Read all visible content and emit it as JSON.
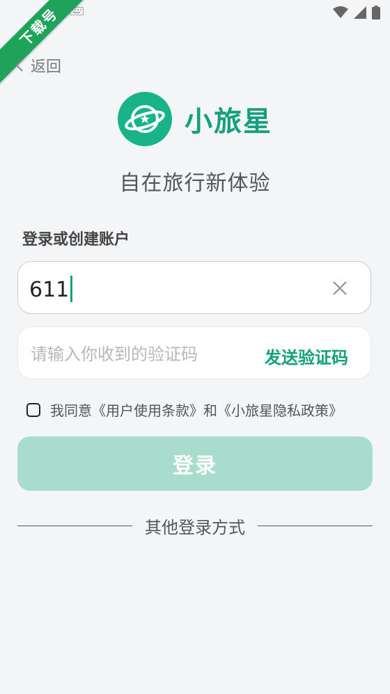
{
  "status_bar": {
    "icons": [
      "keyboard-icon",
      "wifi-icon",
      "signal-icon",
      "battery-icon"
    ]
  },
  "ribbon": {
    "text": "下载号",
    "color": "#1fa35a"
  },
  "nav": {
    "back_label": "返回"
  },
  "brand": {
    "name": "小旅星",
    "color": "#14a07b",
    "logo_color": "#19b38a",
    "logo_icon": "planet-star-icon"
  },
  "tagline": "自在旅行新体验",
  "form": {
    "section_label": "登录或创建账户",
    "phone_value": "611",
    "code_placeholder": "请输入你收到的验证码",
    "send_code_label": "发送验证码",
    "agreement_text": "我同意《用户使用条款》和《小旅星隐私政策》",
    "agreement_checked": false,
    "login_label": "登录",
    "login_button_color": "#a8dccd"
  },
  "other_login": {
    "label": "其他登录方式"
  }
}
